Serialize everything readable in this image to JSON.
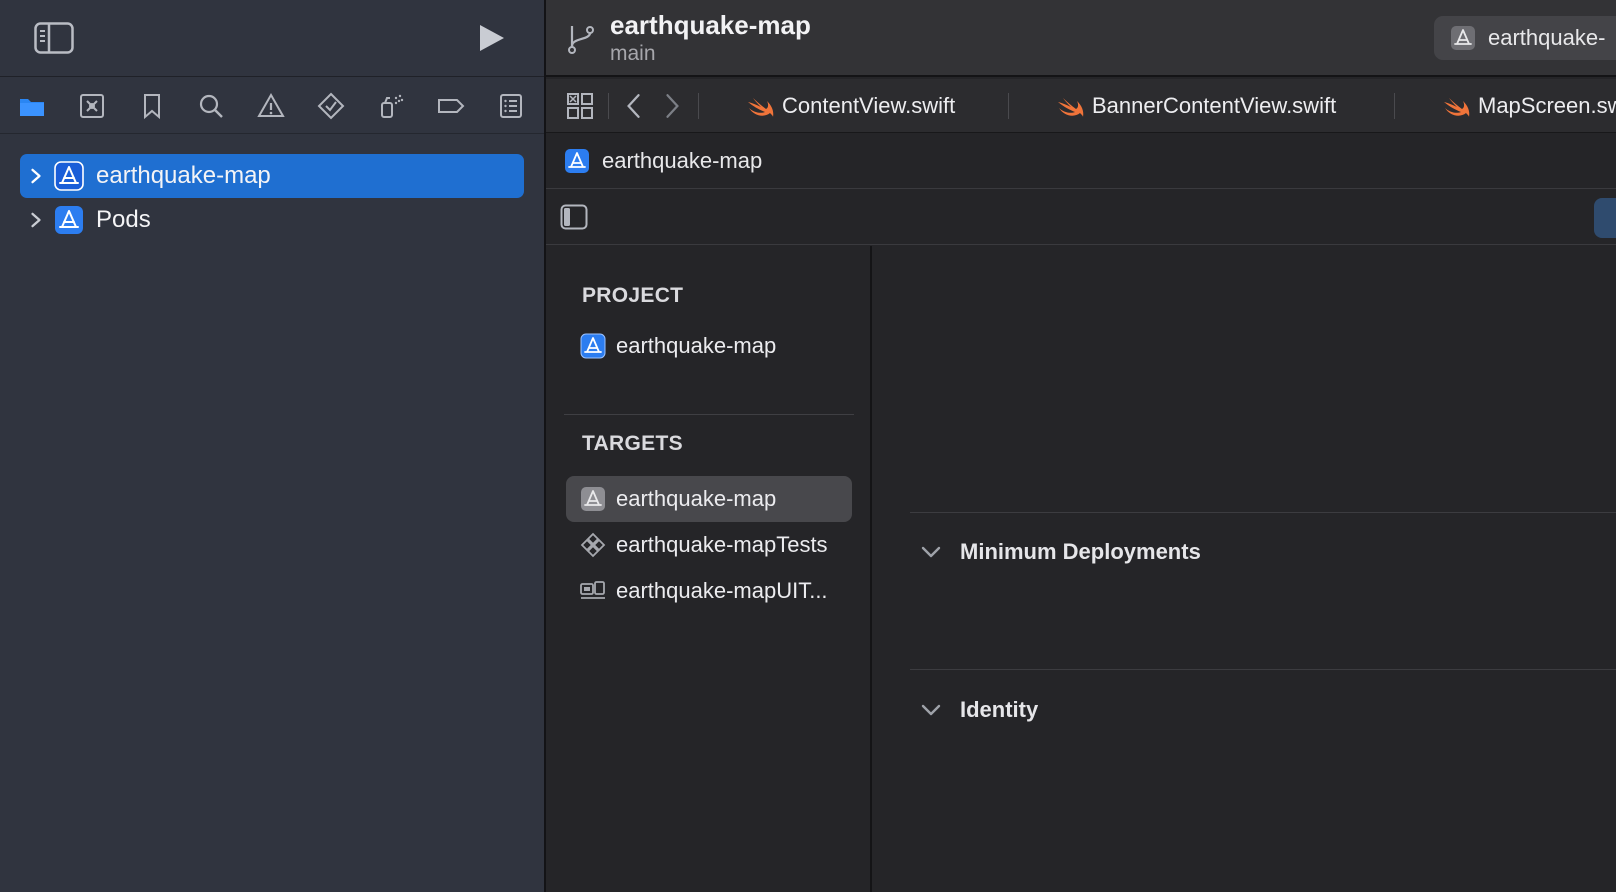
{
  "navigator": {
    "tabs": [
      {
        "icon": "folder-icon"
      },
      {
        "icon": "source-control-icon"
      },
      {
        "icon": "bookmark-icon"
      },
      {
        "icon": "search-icon"
      },
      {
        "icon": "warning-icon"
      },
      {
        "icon": "test-diamond-icon"
      },
      {
        "icon": "debug-spray-icon"
      },
      {
        "icon": "breakpoint-icon"
      },
      {
        "icon": "report-icon"
      }
    ],
    "tree": [
      {
        "label": "earthquake-map",
        "selected": true
      },
      {
        "label": "Pods",
        "selected": false
      }
    ]
  },
  "editor": {
    "title": "earthquake-map",
    "branch": "main",
    "scheme_label": "earthquake-",
    "tabs": [
      {
        "label": "ContentView.swift"
      },
      {
        "label": "BannerContentView.swift"
      },
      {
        "label": "MapScreen.sw"
      }
    ],
    "jump_bar": {
      "label": "earthquake-map"
    }
  },
  "project_list": {
    "project_header": "PROJECT",
    "project_item": "earthquake-map",
    "targets_header": "TARGETS",
    "targets": [
      {
        "label": "earthquake-map",
        "selected": true
      },
      {
        "label": "earthquake-mapTests",
        "selected": false
      },
      {
        "label": "earthquake-mapUIT...",
        "selected": false
      }
    ]
  },
  "settings": {
    "groups": [
      {
        "title": "Minimum Deployments"
      },
      {
        "title": "Identity"
      }
    ]
  },
  "colors": {
    "accent": "#1f6fd1",
    "swift_orange": "#f0743a",
    "navigator_bg": "#30343f",
    "editor_bg": "#252528"
  }
}
